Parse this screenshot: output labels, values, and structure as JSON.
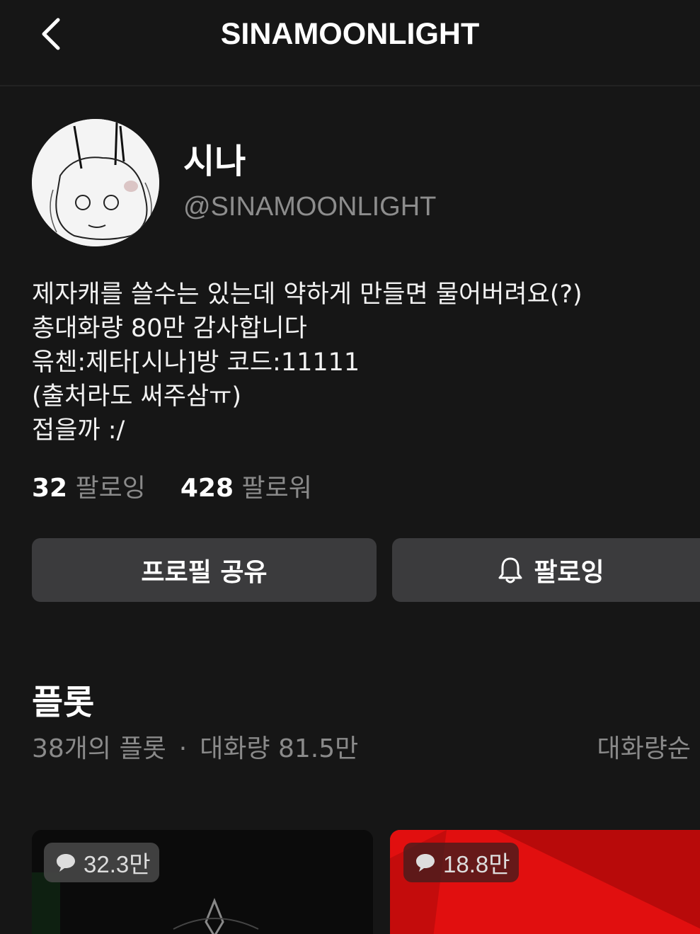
{
  "header": {
    "title": "SINAMOONLIGHT"
  },
  "profile": {
    "display_name": "시나",
    "handle": "@SINAMOONLIGHT",
    "bio": [
      "제자캐를 쓸수는 있는데 약하게 만들면 물어버려요(?)",
      "총대화량 80만 감사합니다",
      "윾첸:제타[시나]방 코드:11111",
      "(출처라도 써주삼ㅠ)",
      "접을까 :/"
    ],
    "following_count": "32",
    "following_label": "팔로잉",
    "followers_count": "428",
    "followers_label": "팔로워"
  },
  "actions": {
    "share_label": "프로필 공유",
    "follow_label": "팔로잉"
  },
  "plots": {
    "title": "플롯",
    "count_text": "38개의 플롯",
    "separator": "·",
    "total_chats": "대화량 81.5만",
    "sort_label": "대화량순",
    "cards": [
      {
        "chats": "32.3만"
      },
      {
        "chats": "18.8만"
      }
    ]
  },
  "icons": {
    "back": "chevron-left-icon",
    "bell": "bell-icon",
    "chat": "chat-bubble-icon"
  },
  "colors": {
    "background": "#161616",
    "button": "#3b3b3d",
    "muted_text": "#8a8a8a",
    "card_red": "#e10f0f"
  }
}
